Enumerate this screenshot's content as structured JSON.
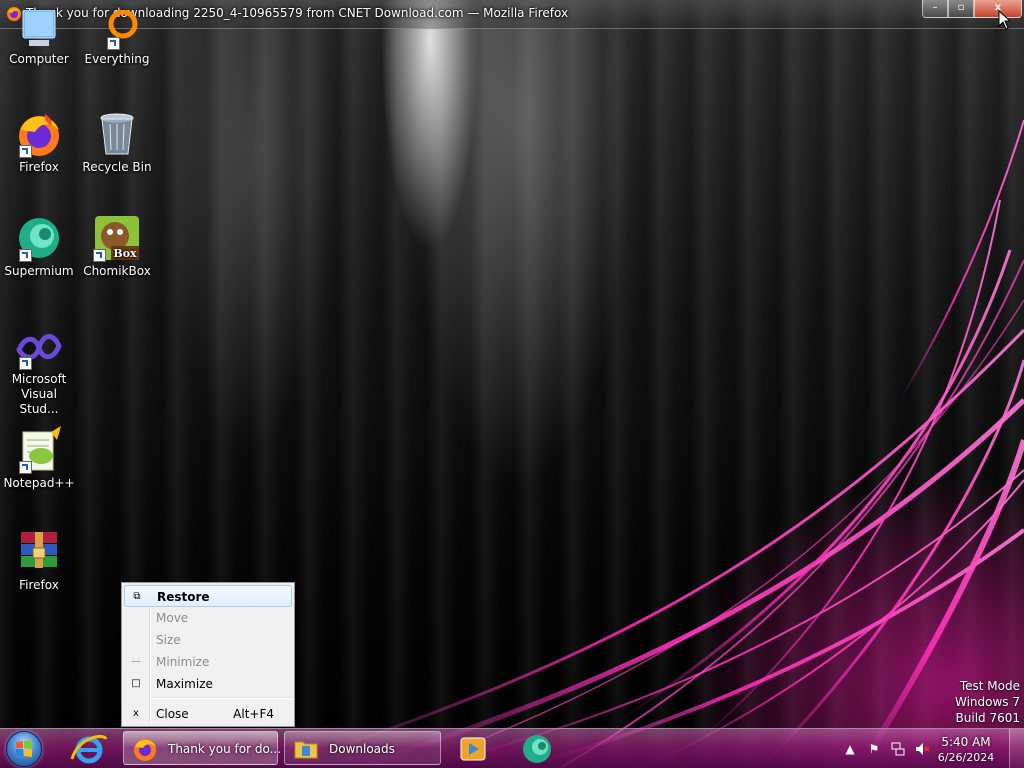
{
  "window": {
    "title": "Thank you for downloading 2250_4-10965579 from CNET Download.com — Mozilla Firefox",
    "controls": {
      "minimize": "–",
      "maximize": "▫",
      "close": "x"
    }
  },
  "desktop_icons": [
    {
      "label": "Computer",
      "icon": "computer-icon"
    },
    {
      "label": "Everything",
      "icon": "everything-icon"
    },
    {
      "label": "Firefox",
      "icon": "firefox-icon"
    },
    {
      "label": "Recycle Bin",
      "icon": "recycle-bin-icon"
    },
    {
      "label": "Supermium",
      "icon": "supermium-icon"
    },
    {
      "label": "ChomikBox",
      "icon": "chomikbox-icon",
      "badge": "Box"
    },
    {
      "label": "Microsoft Visual Stud...",
      "icon": "visual-studio-icon"
    },
    {
      "label": "Notepad++",
      "icon": "notepad-plus-plus-icon"
    },
    {
      "label": "Firefox",
      "icon": "winrar-icon"
    }
  ],
  "context_menu": {
    "items": [
      {
        "icon": "⧉",
        "label": "Restore",
        "shortcut": "",
        "enabled": true,
        "highlighted": true
      },
      {
        "icon": "",
        "label": "Move",
        "shortcut": "",
        "enabled": false
      },
      {
        "icon": "",
        "label": "Size",
        "shortcut": "",
        "enabled": false
      },
      {
        "icon": "—",
        "label": "Minimize",
        "shortcut": "",
        "enabled": false
      },
      {
        "icon": "□",
        "label": "Maximize",
        "shortcut": "",
        "enabled": true
      },
      {
        "icon": "x",
        "label": "Close",
        "shortcut": "Alt+F4",
        "enabled": true
      }
    ]
  },
  "watermark": {
    "line1": "Test Mode",
    "line2": "Windows 7",
    "line3": "Build 7601"
  },
  "taskbar": {
    "pinned": [
      {
        "name": "internet-explorer-icon"
      }
    ],
    "tasks": [
      {
        "label": "Thank you for do...",
        "icon": "firefox-icon",
        "active": true
      },
      {
        "label": "Downloads",
        "icon": "folder-icon",
        "active": false
      }
    ],
    "pinned_after": [
      {
        "name": "media-player-icon"
      },
      {
        "name": "supermium-icon"
      }
    ],
    "tray": {
      "time": "5:40 AM",
      "date": "6/26/2024"
    }
  },
  "colors": {
    "accent_pink": "#e0119a",
    "menu_highlight": "#a8cbef",
    "close_button": "#c4442c"
  }
}
